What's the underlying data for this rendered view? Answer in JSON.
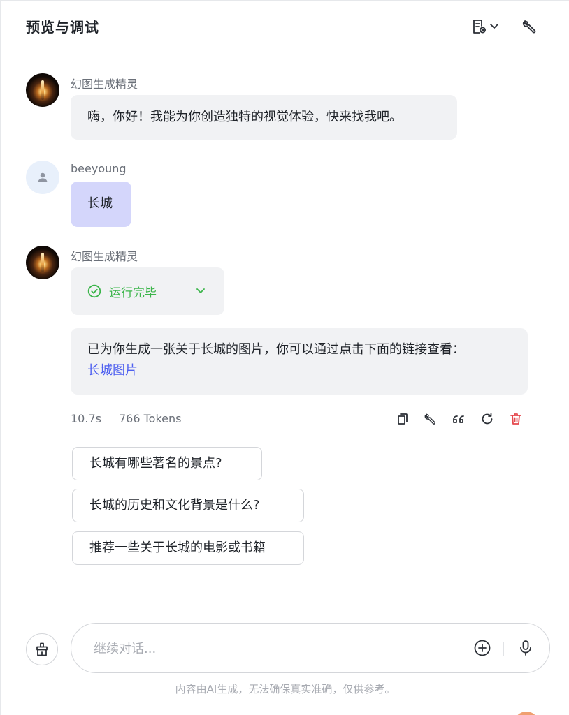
{
  "header": {
    "title": "预览与调试",
    "doc_icon": "doc-settings-icon",
    "chevron_icon": "chevron-down-icon",
    "wrench_icon": "wrench-icon"
  },
  "messages": [
    {
      "sender": "幻图生成精灵",
      "role": "bot",
      "text": "嗨，你好！我能为你创造独特的视觉体验，快来找我吧。"
    },
    {
      "sender": "beeyoung",
      "role": "user",
      "text": "长城"
    },
    {
      "sender": "幻图生成精灵",
      "role": "bot",
      "status": "运行完毕",
      "text": "已为你生成一张关于长城的图片，你可以通过点击下面的链接查看：",
      "link": "长城图片",
      "duration": "10.7s",
      "tokens": "766 Tokens"
    }
  ],
  "actions": [
    "copy-icon",
    "wrench-icon",
    "quote-icon",
    "refresh-icon",
    "delete-icon"
  ],
  "suggestions": [
    "长城有哪些著名的景点?",
    "长城的历史和文化背景是什么?",
    "推荐一些关于长城的电影或书籍"
  ],
  "input": {
    "placeholder": "继续对话..."
  },
  "disclaimer": "内容由AI生成，无法确保真实准确，仅供参考。",
  "colors": {
    "success": "#3bb54a",
    "link": "#4d5ff0",
    "danger": "#e5484d",
    "user_bubble": "#d4d6fb",
    "bot_bubble": "#f1f2f4"
  }
}
